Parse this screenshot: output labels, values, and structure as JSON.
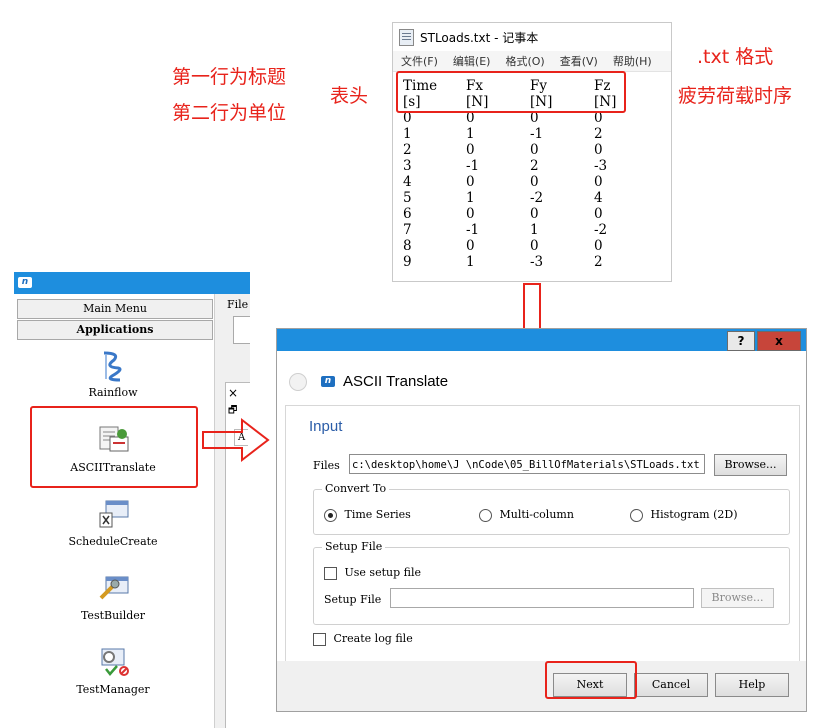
{
  "annotations": {
    "row1": "第一行为标题",
    "row2": "第二行为单位",
    "header": "表头",
    "format": ".txt 格式",
    "series": "疲劳荷载时序"
  },
  "notepad": {
    "title": "STLoads.txt - 记事本",
    "menu": [
      "文件(F)",
      "编辑(E)",
      "格式(O)",
      "查看(V)",
      "帮助(H)"
    ],
    "header": [
      "Time",
      "Fx",
      "Fy",
      "Fz"
    ],
    "units": [
      "[s]",
      "[N]",
      "[N]",
      "[N]"
    ],
    "rows": [
      [
        "0",
        "0",
        "0",
        "0"
      ],
      [
        "1",
        "1",
        "-1",
        "2"
      ],
      [
        "2",
        "0",
        "0",
        "0"
      ],
      [
        "3",
        "-1",
        "2",
        "-3"
      ],
      [
        "4",
        "0",
        "0",
        "0"
      ],
      [
        "5",
        "1",
        "-2",
        "4"
      ],
      [
        "6",
        "0",
        "0",
        "0"
      ],
      [
        "7",
        "-1",
        "1",
        "-2"
      ],
      [
        "8",
        "0",
        "0",
        "0"
      ],
      [
        "9",
        "1",
        "-3",
        "2"
      ]
    ]
  },
  "main_window": {
    "logo": "n",
    "file_label": "File",
    "main_menu": "Main Menu",
    "applications": "Applications",
    "apps": [
      "Rainflow",
      "ASCIITranslate",
      "ScheduleCreate",
      "TestBuilder",
      "TestManager"
    ],
    "side_close": "×",
    "side_restore": "🗗",
    "side_tab": "A"
  },
  "dialog": {
    "help_btn": "?",
    "close_btn": "x",
    "title": "ASCII Translate",
    "logo": "n",
    "section": "Input",
    "files_label": "Files",
    "files_value": "c:\\desktop\\home\\J     \\nCode\\05_BillOfMaterials\\STLoads.txt",
    "browse": "Browse...",
    "convert_to": {
      "title": "Convert To",
      "options": [
        "Time Series",
        "Multi-column",
        "Histogram (2D)"
      ],
      "selected": "Time Series"
    },
    "setup_file": {
      "title": "Setup File",
      "use_label": "Use setup file",
      "use_checked": false,
      "field_label": "Setup File",
      "field_value": "",
      "browse": "Browse..."
    },
    "create_log_label": "Create log file",
    "create_log_checked": false,
    "buttons": {
      "next": "Next",
      "cancel": "Cancel",
      "help": "Help"
    }
  },
  "colors": {
    "accent_blue": "#1e8ede",
    "annotation_red": "#e8231b",
    "close_red": "#c7453a",
    "dialog_heading": "#2b5da8"
  }
}
